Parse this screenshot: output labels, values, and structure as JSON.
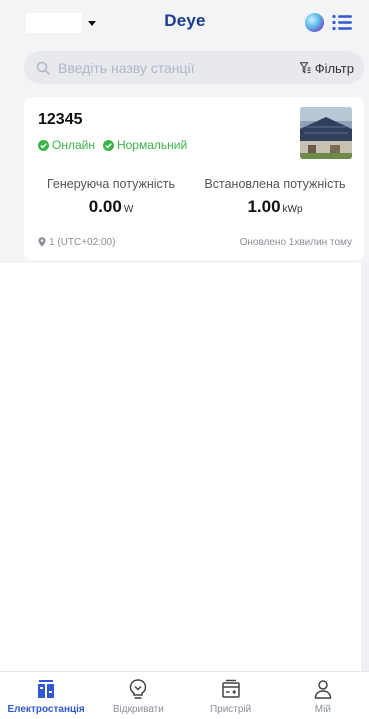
{
  "header": {
    "brand": "Deye",
    "brand_color": "#1a3b8f"
  },
  "search": {
    "placeholder": "Введіть назву станції",
    "value": "",
    "filter_label": "Фільтр"
  },
  "station": {
    "name": "12345",
    "statuses": [
      "Онлайн",
      "Нормальний"
    ],
    "status_color": "#3bb54a",
    "generation_label": "Генеруюча потужність",
    "generation_value": "0.00",
    "generation_unit": "W",
    "installed_label": "Встановлена потужність",
    "installed_value": "1.00",
    "installed_unit": "kWp",
    "location": "1 (UTC+02:00)",
    "updated": "Оновлено 1хвилин тому"
  },
  "nav": {
    "accent": "#2f57d6",
    "items": [
      {
        "label": "Електростанція",
        "icon": "solar-panel-icon",
        "active": true
      },
      {
        "label": "Відкривати",
        "icon": "lightbulb-icon",
        "active": false
      },
      {
        "label": "Пристрій",
        "icon": "battery-device-icon",
        "active": false
      },
      {
        "label": "Мій",
        "icon": "user-icon",
        "active": false
      }
    ]
  }
}
